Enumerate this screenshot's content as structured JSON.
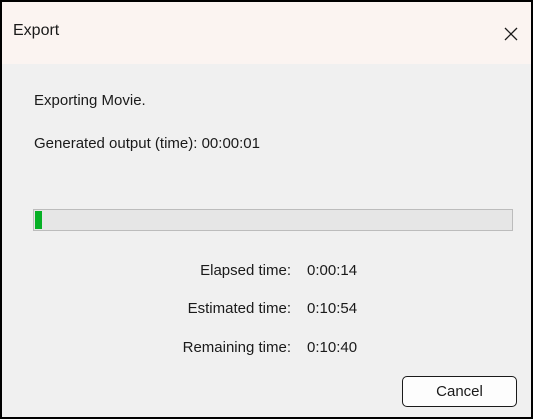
{
  "window": {
    "title": "Export",
    "close_icon": "close-icon"
  },
  "content": {
    "status_message": "Exporting Movie.",
    "generated_output_label": "Generated output (time): 00:00:01"
  },
  "progress": {
    "fraction": 0.015,
    "fill_color": "#06b025",
    "track_color": "#e6e6e6"
  },
  "stats": {
    "elapsed_label": "Elapsed time:",
    "elapsed_value": "0:00:14",
    "estimated_label": "Estimated time:",
    "estimated_value": "0:10:54",
    "remaining_label": "Remaining time:",
    "remaining_value": "0:10:40"
  },
  "buttons": {
    "cancel_label": "Cancel"
  }
}
